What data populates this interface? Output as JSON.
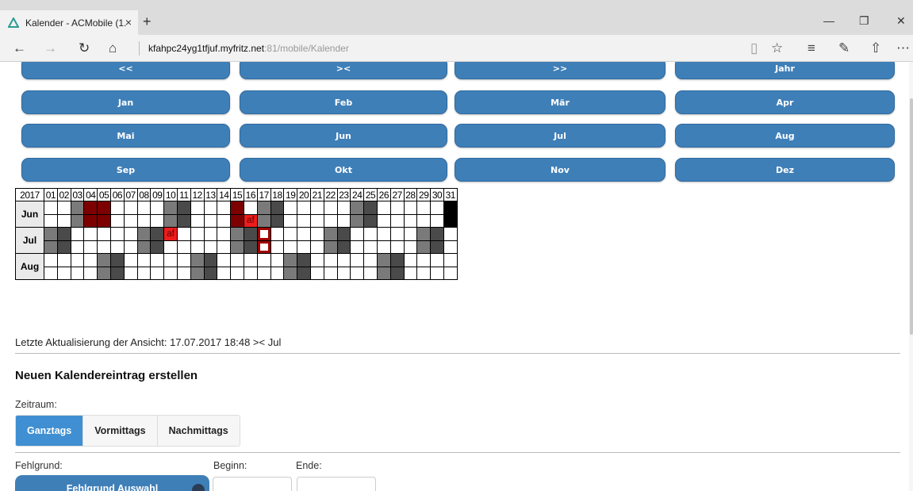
{
  "browser": {
    "tab_title": "Kalender - ACMobile (1.",
    "tab_close": "×",
    "new_tab": "+",
    "url_host": "kfahpc24yg1tfjuf.myfritz.net",
    "url_path": ":81/mobile/Kalender",
    "minimize": "—",
    "restore": "❐",
    "close": "✕"
  },
  "nav_buttons": {
    "prev": "<<",
    "current": "><",
    "next": ">>",
    "year": "Jahr"
  },
  "months": [
    "Jan",
    "Feb",
    "Mär",
    "Apr",
    "Mai",
    "Jun",
    "Jul",
    "Aug",
    "Sep",
    "Okt",
    "Nov",
    "Dez"
  ],
  "calendar": {
    "year": "2017",
    "days": [
      "01",
      "02",
      "03",
      "04",
      "05",
      "06",
      "07",
      "08",
      "09",
      "10",
      "11",
      "12",
      "13",
      "14",
      "15",
      "16",
      "17",
      "18",
      "19",
      "20",
      "21",
      "22",
      "23",
      "24",
      "25",
      "26",
      "27",
      "28",
      "29",
      "30",
      "31"
    ],
    "rows": [
      {
        "label": "Jun"
      },
      {
        "label": "Jul"
      },
      {
        "label": "Aug"
      }
    ],
    "cell_marker": "af"
  },
  "last_update": "Letzte Aktualisierung der Ansicht: 17.07.2017 18:48 >< Jul",
  "new_entry": {
    "title": "Neuen Kalendereintrag erstellen",
    "zeitraum_label": "Zeitraum:",
    "options": [
      "Ganztags",
      "Vormittags",
      "Nachmittags"
    ],
    "fehlgrund_label": "Fehlgrund:",
    "beginn_label": "Beginn:",
    "ende_label": "Ende:",
    "fehlgrund_select": "Fehlgrund Auswahl"
  },
  "colors": {
    "button_blue": "#3f7fb8",
    "weekend_gray": "#7a7a7a",
    "absence_darkred": "#7d0000",
    "absence_red": "#ee1c1c",
    "selected_border": "#a00000"
  }
}
